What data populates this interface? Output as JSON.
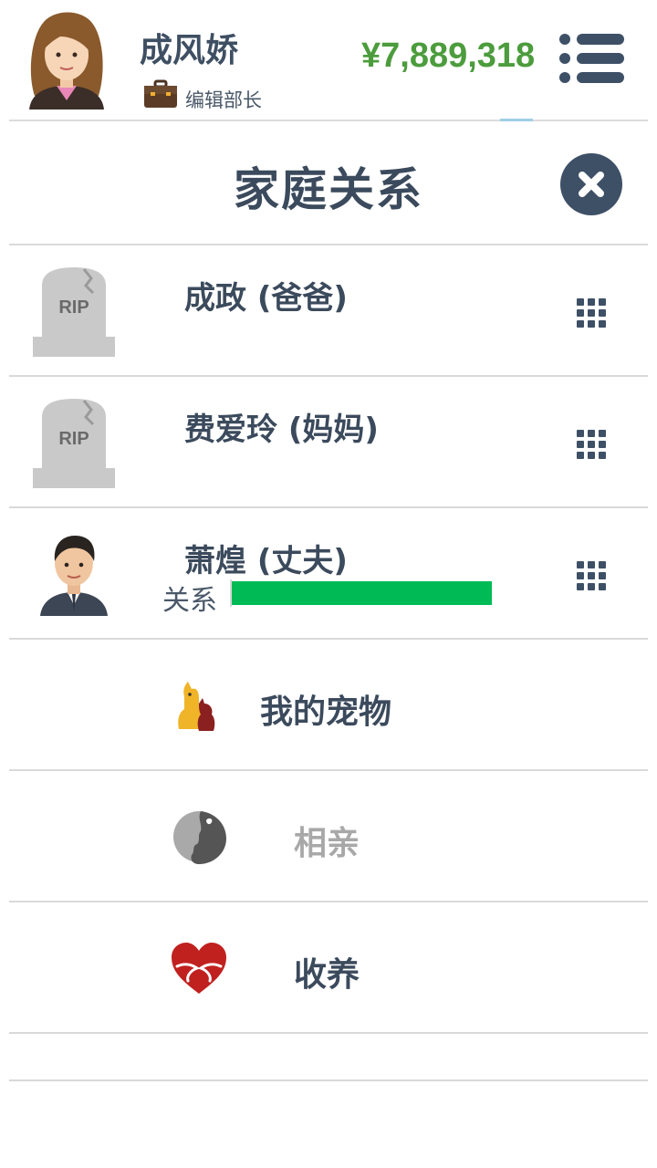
{
  "header": {
    "user_name": "成风娇",
    "job_title": "编辑部长",
    "money": "¥7,889,318",
    "icons": {
      "avatar": "female-avatar",
      "job": "briefcase-icon",
      "menu": "menu-icon"
    }
  },
  "page": {
    "title": "家庭关系",
    "close_icon": "close-icon"
  },
  "family": [
    {
      "name": "成政 (爸爸)",
      "icon": "tombstone-rip-icon",
      "status": "deceased"
    },
    {
      "name": "费爱玲 (妈妈)",
      "icon": "tombstone-rip-icon",
      "status": "deceased"
    },
    {
      "name": "萧煌 (丈夫)",
      "icon": "male-avatar",
      "status": "alive",
      "relation_label": "关系",
      "relation_level": 0.99
    }
  ],
  "tombstone_text": "RIP",
  "menu": [
    {
      "label": "我的宠物",
      "icon": "pets-icon",
      "enabled": true
    },
    {
      "label": "相亲",
      "icon": "dating-icon",
      "enabled": false
    },
    {
      "label": "收养",
      "icon": "adopt-heart-icon",
      "enabled": true
    }
  ],
  "colors": {
    "money": "#4c9c3d",
    "text": "#3b4a5c",
    "close_bg": "#3e5066",
    "relation_bar": "#00bb55",
    "disabled": "#a8a8a8"
  }
}
